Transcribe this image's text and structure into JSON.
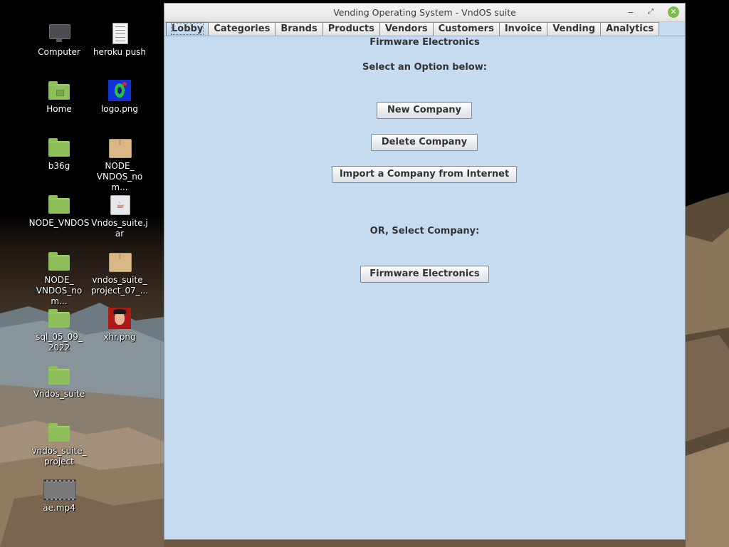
{
  "desktop": {
    "icons": [
      {
        "label": "Computer",
        "icon": "computer-icon"
      },
      {
        "label": "heroku push",
        "icon": "text-file-icon"
      },
      {
        "label": "Home",
        "icon": "home-folder-icon"
      },
      {
        "label": "logo.png",
        "icon": "image-file-icon"
      },
      {
        "label": "b36g",
        "icon": "folder-icon"
      },
      {
        "label": "NODE_\nVNDOS_nom...",
        "icon": "archive-file-icon"
      },
      {
        "label": "NODE_VNDOS",
        "icon": "folder-icon"
      },
      {
        "label": "Vndos_suite.jar",
        "icon": "java-jar-file-icon"
      },
      {
        "label": "NODE_\nVNDOS_nom...",
        "icon": "folder-icon"
      },
      {
        "label": "vndos_suite_\nproject_07_...",
        "icon": "archive-file-icon"
      },
      {
        "label": "sql_05_09_\n2022",
        "icon": "folder-icon"
      },
      {
        "label": "xhr.png",
        "icon": "image-file-icon"
      },
      {
        "label": "Vndos_suite",
        "icon": "folder-icon"
      },
      {
        "label": "vndos_suite_\nproject",
        "icon": "folder-icon"
      },
      {
        "label": "ae.mp4",
        "icon": "video-file-icon"
      }
    ]
  },
  "window": {
    "title": "Vending Operating System - VndOS suite",
    "controls": {
      "minimize": "‒",
      "maximize": "⤢",
      "close": "✕"
    },
    "tabs": [
      {
        "label": "Lobby",
        "active": true
      },
      {
        "label": "Categories",
        "active": false
      },
      {
        "label": "Brands",
        "active": false
      },
      {
        "label": "Products",
        "active": false
      },
      {
        "label": "Vendors",
        "active": false
      },
      {
        "label": "Customers",
        "active": false
      },
      {
        "label": "Invoice",
        "active": false
      },
      {
        "label": "Vending",
        "active": false
      },
      {
        "label": "Analytics",
        "active": false
      }
    ]
  },
  "lobby": {
    "company_title": "Firmware Electronics",
    "select_option_label": "Select an Option below:",
    "new_company_button": "New Company",
    "delete_company_button": "Delete Company",
    "import_company_button": "Import a Company from Internet",
    "or_select_label": "OR, Select Company:",
    "companies": [
      "Firmware Electronics"
    ]
  },
  "colors": {
    "panel_background": "#c7dbf0",
    "folder_green": "#8fbf5a",
    "close_button": "#7dbb4a"
  }
}
